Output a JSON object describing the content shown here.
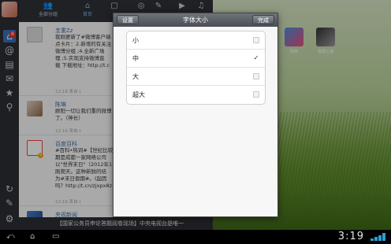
{
  "dialog": {
    "title": "字体大小",
    "back_button": "设置",
    "done_button": "完成",
    "options": [
      {
        "label": "小",
        "selected": false
      },
      {
        "label": "中",
        "selected": true
      },
      {
        "label": "大",
        "selected": false
      },
      {
        "label": "超大",
        "selected": false
      }
    ],
    "check_mark": "✓"
  },
  "sidebar": {
    "badge": "8"
  },
  "topbar": {
    "tabs": [
      {
        "icon": "people-icon",
        "label": "全部分组"
      },
      {
        "icon": "home-icon",
        "label": "首页"
      },
      {
        "icon": "edit-icon",
        "label": ""
      },
      {
        "icon": "compass-icon",
        "label": ""
      },
      {
        "icon": "pencil-icon",
        "label": ""
      },
      {
        "icon": "play-icon",
        "label": ""
      },
      {
        "icon": "music-icon",
        "label": ""
      }
    ]
  },
  "feed": [
    {
      "name": "圭重Zz",
      "text": "我刚更新了#微博客户端\n点卡片：2.新增的有关注\n微博分组 ;4.全新广场 \n理 ;5.实现支持微博直\n载 下载地址：http://t.c",
      "time": "12:18 来自 t"
    },
    {
      "name": "陈琳",
      "text": "顾阳一切让我们重的微博\n了。（神长）",
      "time": "12:16 来自 t"
    },
    {
      "name": "百度百科",
      "text": "#百科•热词#【世纪比较\n期是成都一家网络公司\n以\"世界末日\"（2012年1\n刚爬天。这种新鲜的结\n为#末日假期#。(起因\n吗？http://t.cn/zjxpx8z",
      "time": "12:16 来自 t"
    },
    {
      "name": "央视新闻",
      "text": "",
      "time": ""
    }
  ],
  "footer_text": "【国家公务员申论答题阅卷现场】中央电视台是唯一",
  "home": {
    "icon_labels": [
      "购物",
      "极限之速"
    ]
  },
  "status_bar": {
    "clock": "3:19"
  },
  "colors": {
    "dialog_header": "#4a4e54",
    "accent": "#3b6fb6",
    "link": "#3a6ea5"
  }
}
